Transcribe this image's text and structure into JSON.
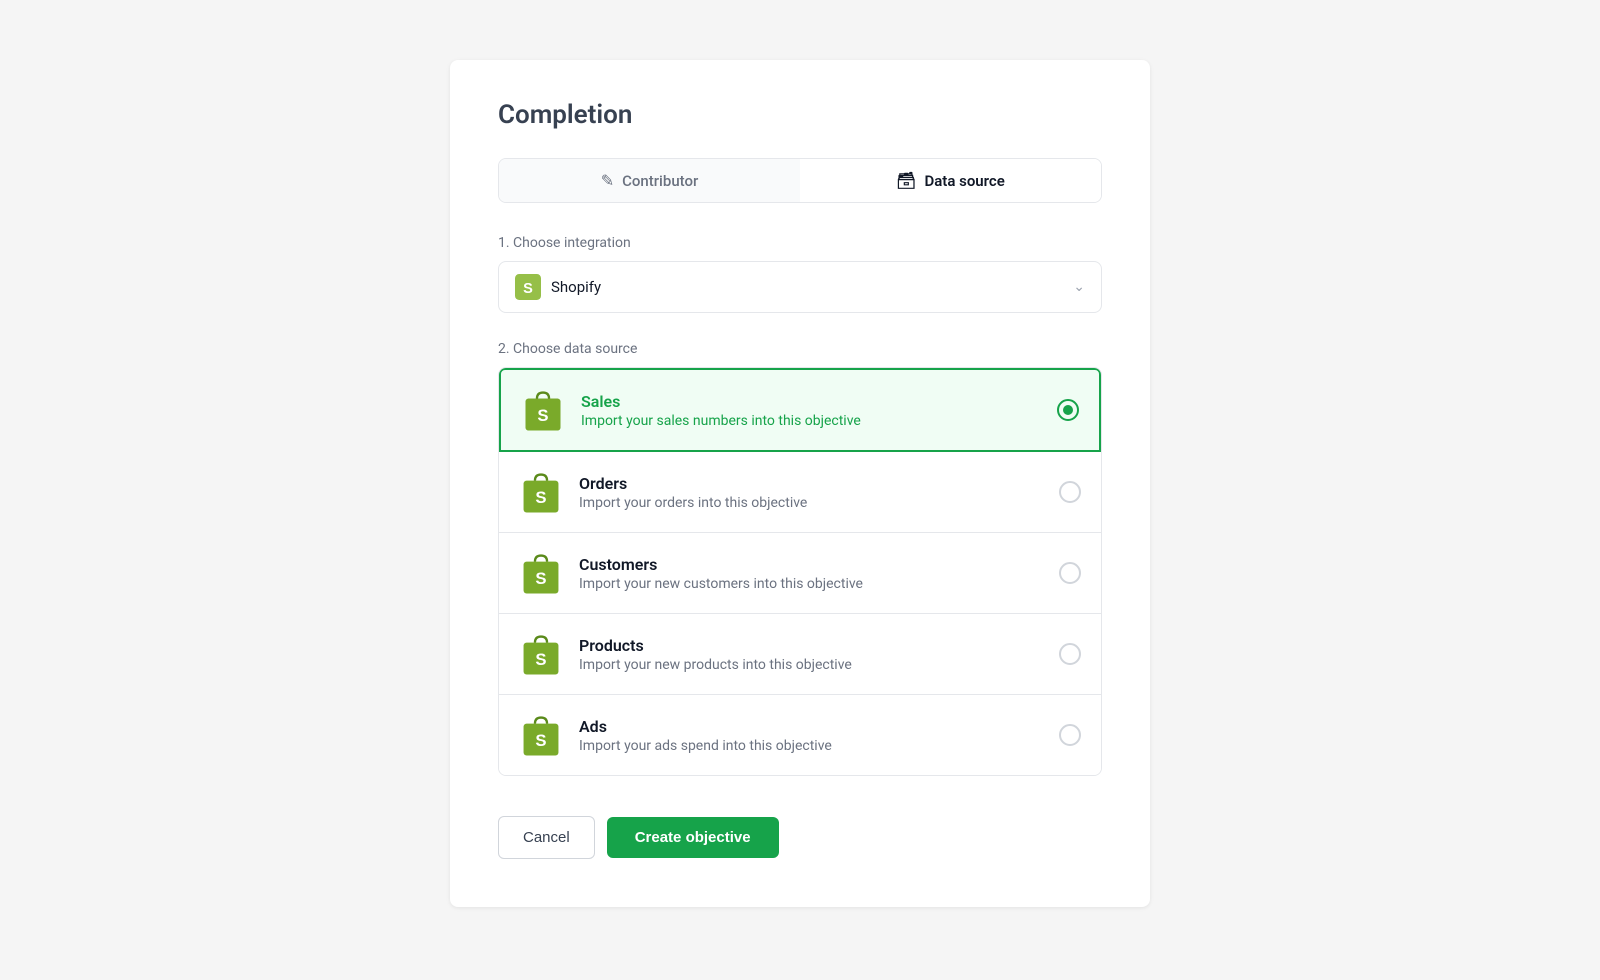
{
  "page": {
    "title": "Completion",
    "tabs": [
      {
        "id": "contributor",
        "label": "Contributor",
        "icon": "person",
        "active": false
      },
      {
        "id": "data-source",
        "label": "Data source",
        "icon": "database",
        "active": true
      }
    ],
    "sections": {
      "integration": {
        "label": "1. Choose integration",
        "selected": "Shopify"
      },
      "dataSource": {
        "label": "2. Choose data source",
        "items": [
          {
            "id": "sales",
            "name": "Sales",
            "description": "Import your sales numbers into this objective",
            "selected": true
          },
          {
            "id": "orders",
            "name": "Orders",
            "description": "Import your orders into this objective",
            "selected": false
          },
          {
            "id": "customers",
            "name": "Customers",
            "description": "Import your new customers into this objective",
            "selected": false
          },
          {
            "id": "products",
            "name": "Products",
            "description": "Import your new products into this objective",
            "selected": false
          },
          {
            "id": "ads",
            "name": "Ads",
            "description": "Import your ads spend into this objective",
            "selected": false
          }
        ]
      }
    },
    "buttons": {
      "cancel": "Cancel",
      "create": "Create objective"
    }
  }
}
